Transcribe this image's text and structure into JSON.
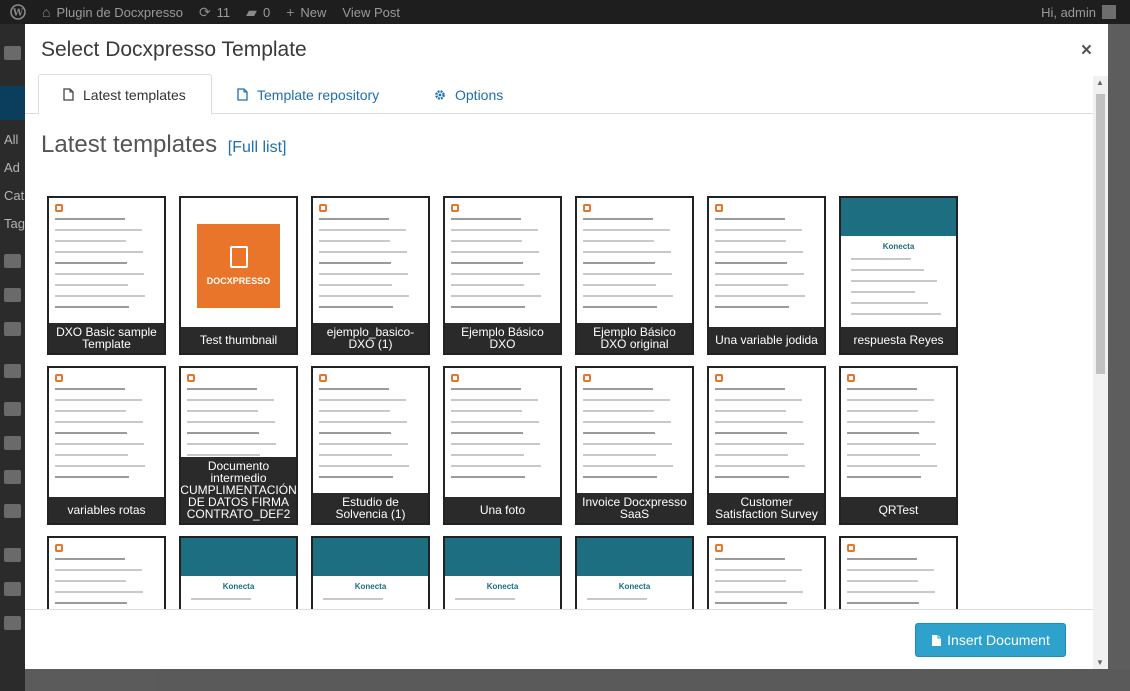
{
  "adminbar": {
    "site_name": "Plugin de Docxpresso",
    "updates": "11",
    "comments": "0",
    "new": "New",
    "view_post": "View Post",
    "greeting": "Hi, admin"
  },
  "wp_sidebar": {
    "labels": [
      "All",
      "Ad",
      "Cat",
      "Tag"
    ]
  },
  "modal": {
    "title": "Select Docxpresso Template",
    "close_label": "×",
    "tabs": [
      {
        "label": "Latest templates",
        "icon": "file-icon"
      },
      {
        "label": "Template repository",
        "icon": "file-icon"
      },
      {
        "label": "Options",
        "icon": "gear-icon"
      }
    ],
    "section_title": "Latest templates",
    "full_list_link": "[Full list]",
    "templates": [
      {
        "caption": "DXO Basic sample Template"
      },
      {
        "caption": "Test thumbnail",
        "brand": "DOCXPRESSO"
      },
      {
        "caption": "ejemplo_basico-DXO (1)"
      },
      {
        "caption": "Ejemplo Básico DXO"
      },
      {
        "caption": "Ejemplo Básico DXO original"
      },
      {
        "caption": "Una variable jodida"
      },
      {
        "caption": "respuesta Reyes",
        "doc_title": "Konecta"
      },
      {
        "caption": "variables rotas"
      },
      {
        "caption": "Documento intermedio CUMPLIMENTACIÓN DE DATOS FIRMA CONTRATO_DEF2"
      },
      {
        "caption": "Estudio de Solvencia (1)"
      },
      {
        "caption": "Una foto"
      },
      {
        "caption": "Invoice Docxpresso SaaS"
      },
      {
        "caption": "Customer Satisfaction Survey"
      },
      {
        "caption": "QRTest"
      },
      {
        "caption": ""
      },
      {
        "caption": "",
        "doc_title": "Konecta"
      },
      {
        "caption": "",
        "doc_title": "Konecta"
      },
      {
        "caption": "",
        "doc_title": "Konecta"
      },
      {
        "caption": "",
        "doc_title": "Konecta"
      },
      {
        "caption": ""
      },
      {
        "caption": ""
      }
    ],
    "insert_button": "Insert Document"
  },
  "colors": {
    "accent": "#2ea2cc",
    "link": "#1f6fad",
    "docxpresso_orange": "#e8752a"
  }
}
